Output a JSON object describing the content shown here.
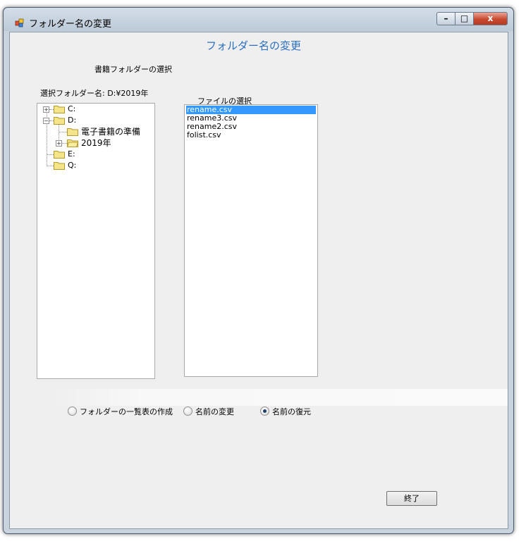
{
  "window": {
    "title": "フォルダー名の変更",
    "controls": {
      "minimize": "–",
      "maximize": "□",
      "close": "x"
    }
  },
  "form": {
    "heading": "フォルダー名の変更",
    "book_folder_label": "書籍フォルダーの選択",
    "selected_folder_label": "選択フォルダー名: D:¥2019年",
    "file_select_label": "ファイルの選択"
  },
  "tree": {
    "nodes": [
      {
        "label": "C:",
        "expander": "+"
      },
      {
        "label": "D:",
        "expander": "−"
      },
      {
        "label": "電子書籍の準備"
      },
      {
        "label": "2019年",
        "expander": "+"
      },
      {
        "label": "E:"
      },
      {
        "label": "Q:"
      }
    ]
  },
  "file_list": {
    "items": [
      "rename.csv",
      "rename3.csv",
      "rename2.csv",
      "folist.csv"
    ],
    "selected": "rename.csv"
  },
  "radios": [
    {
      "label": "フォルダーの一覧表の作成",
      "checked": false
    },
    {
      "label": "名前の変更",
      "checked": false
    },
    {
      "label": "名前の復元",
      "checked": true
    }
  ],
  "buttons": {
    "exit": "終了"
  },
  "colors": {
    "heading": "#2a6fc0",
    "selection": "#3399ff",
    "folder": "#f5e58a"
  }
}
